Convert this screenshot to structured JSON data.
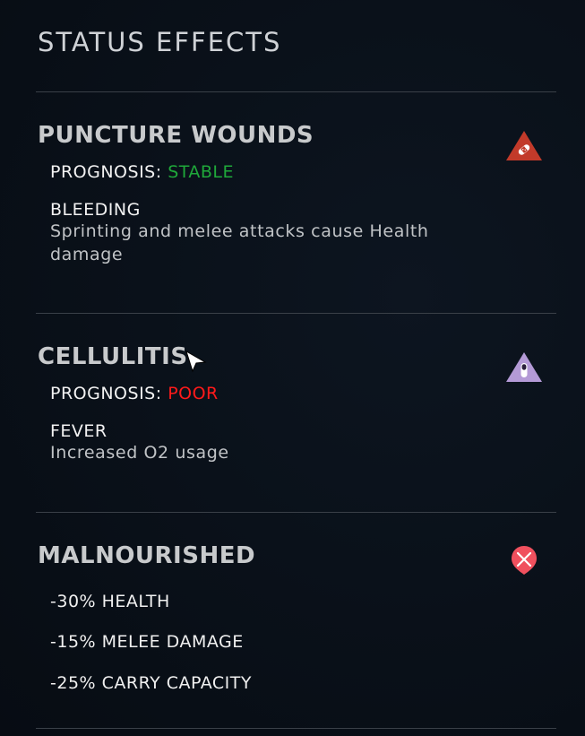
{
  "page": {
    "title": "STATUS EFFECTS"
  },
  "effects": [
    {
      "name": "PUNCTURE WOUNDS",
      "icon": "bandage-warning-icon",
      "icon_color": "#c23a2a",
      "prognosis_label": "PROGNOSIS:",
      "prognosis_value": "STABLE",
      "prognosis_color": "#1fa83a",
      "symptom_title": "BLEEDING",
      "symptom_desc": "Sprinting and melee attacks cause Health damage"
    },
    {
      "name": "CELLULITIS",
      "icon": "pill-warning-icon",
      "icon_color": "#b49ad6",
      "prognosis_label": "PROGNOSIS:",
      "prognosis_value": "POOR",
      "prognosis_color": "#ff1a1a",
      "symptom_title": "FEVER",
      "symptom_desc": "Increased O2 usage"
    },
    {
      "name": "MALNOURISHED",
      "icon": "fork-knife-icon",
      "icon_color": "#f0505e",
      "penalties": [
        "-30% HEALTH",
        "-15% MELEE DAMAGE",
        "-25% CARRY CAPACITY"
      ]
    }
  ]
}
